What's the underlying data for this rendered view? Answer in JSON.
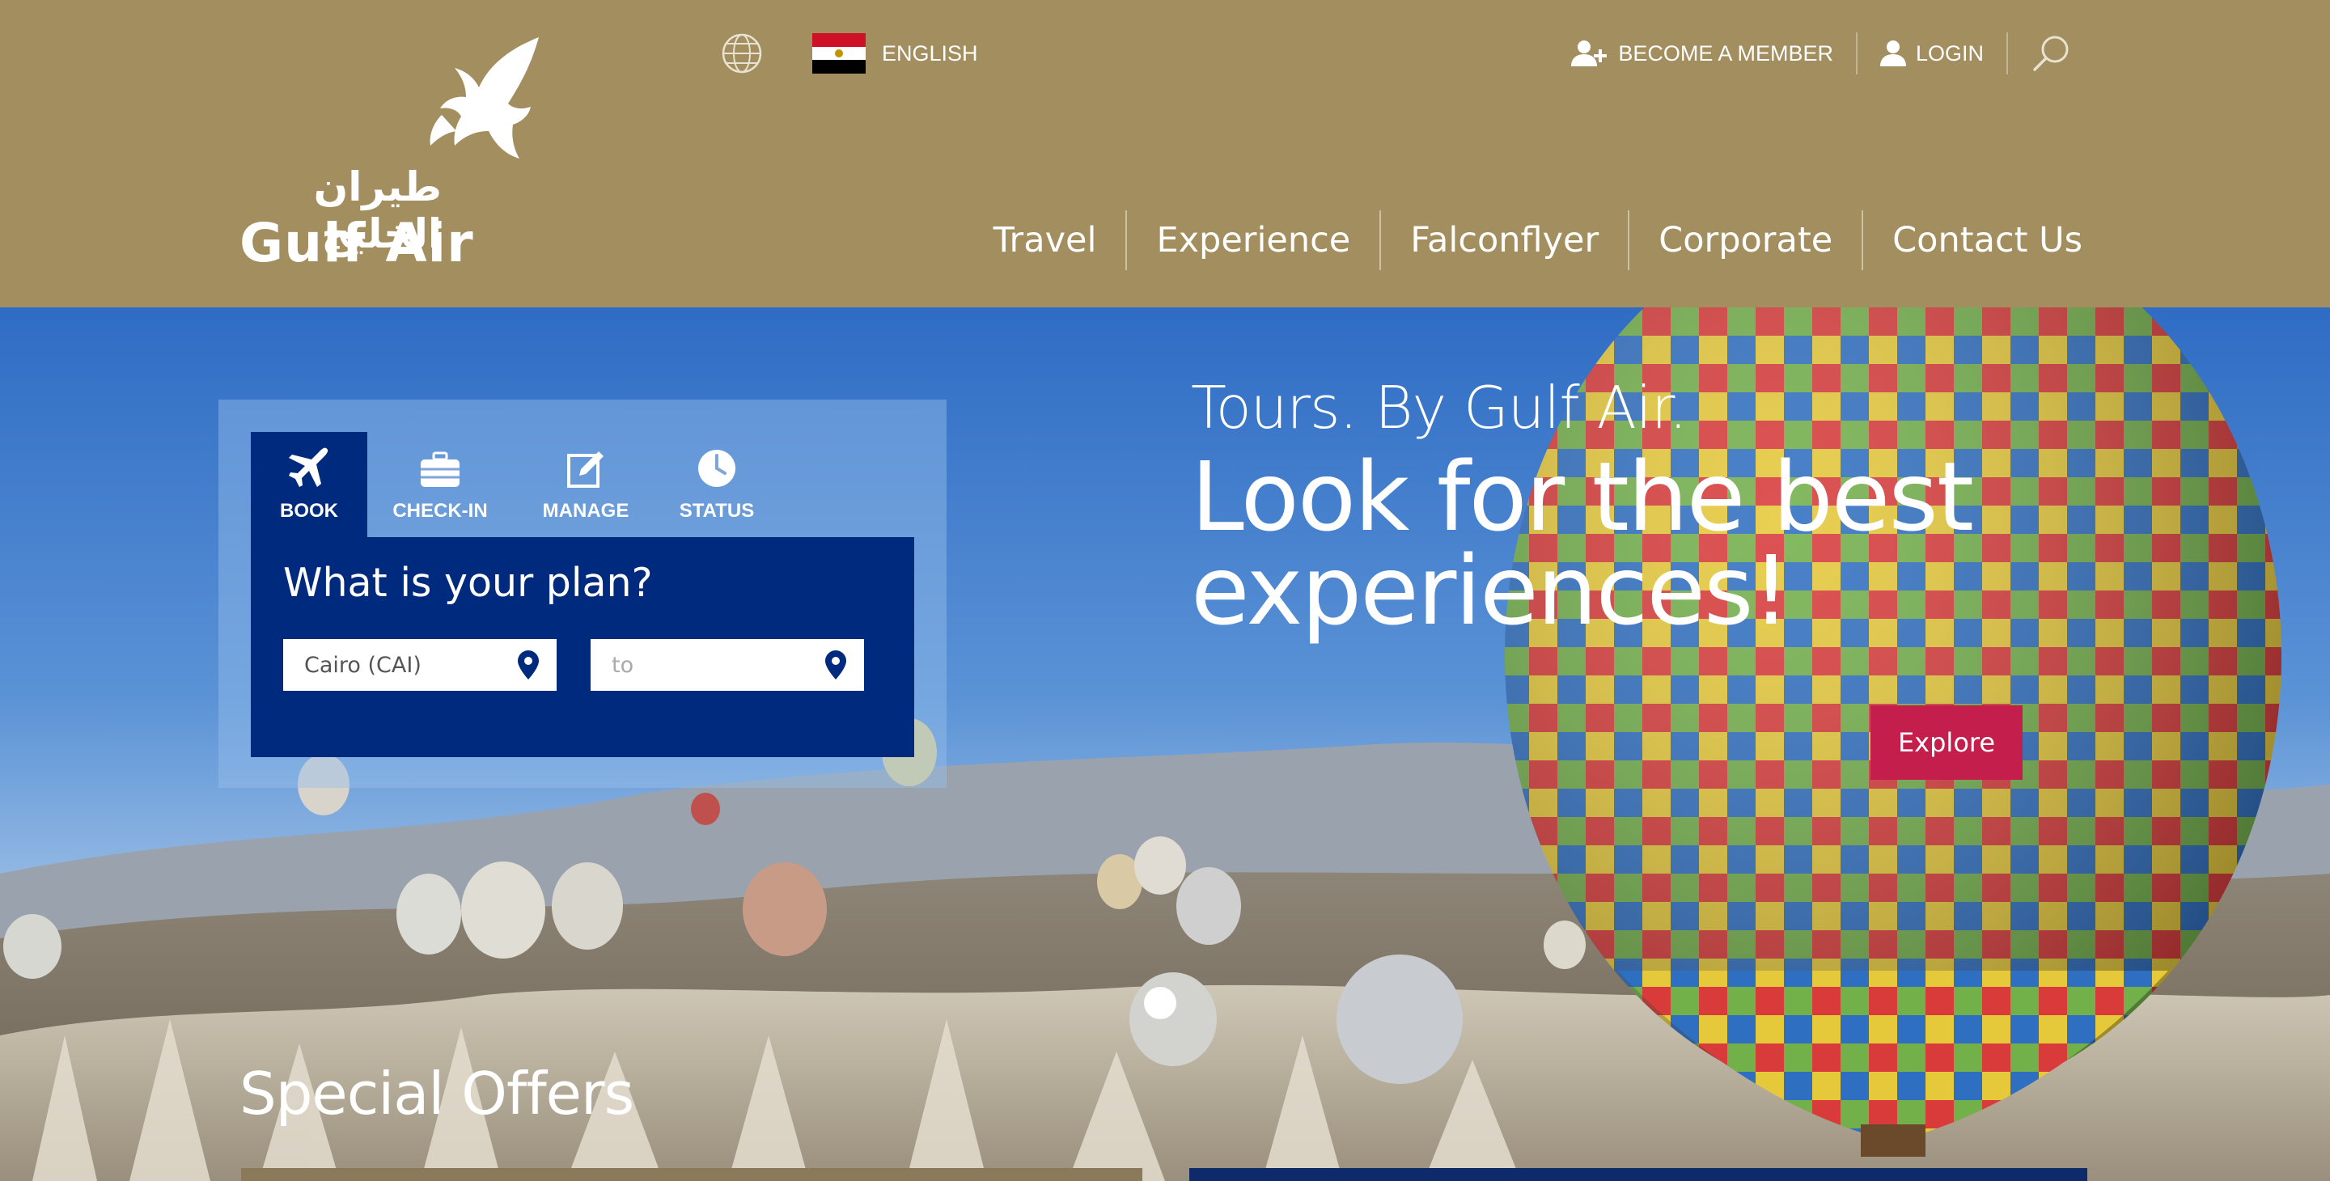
{
  "brand": {
    "name": "Gulf Air",
    "arabic_name": "طيران الخليج"
  },
  "colors": {
    "header_bg": "#a28e5e",
    "booking_panel": "#002a7e",
    "explore_button": "#c41f4c"
  },
  "language": {
    "label": "ENGLISH",
    "icons": [
      "globe-icon",
      "egypt-flag-icon"
    ]
  },
  "top_links": {
    "member_label": "BECOME A MEMBER",
    "login_label": "LOGIN",
    "icons": [
      "add-user-icon",
      "user-icon",
      "search-icon"
    ]
  },
  "nav": {
    "items": [
      "Travel",
      "Experience",
      "Falconflyer",
      "Corporate",
      "Contact Us"
    ]
  },
  "booking": {
    "tabs": [
      {
        "label": "BOOK",
        "icon": "plane-icon",
        "active": true
      },
      {
        "label": "CHECK-IN",
        "icon": "suitcase-icon",
        "active": false
      },
      {
        "label": "MANAGE",
        "icon": "edit-icon",
        "active": false
      },
      {
        "label": "STATUS",
        "icon": "clock-icon",
        "active": false
      }
    ],
    "title": "What is your plan?",
    "from_value": "Cairo (CAI)",
    "to_placeholder": "to"
  },
  "hero": {
    "subtitle": "Tours. By Gulf Air.",
    "title_line1": "Look for the best",
    "title_line2": "experiences!",
    "cta_label": "Explore"
  },
  "offers": {
    "title": "Special Offers"
  }
}
